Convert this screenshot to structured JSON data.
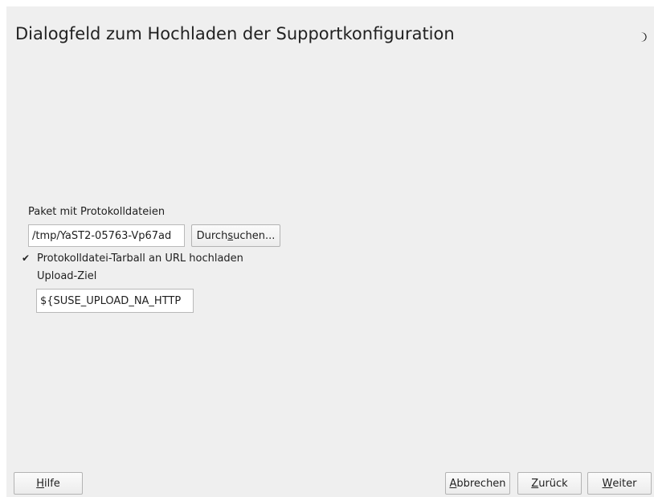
{
  "dialog": {
    "title": "Dialogfeld zum Hochladen der Supportkonfiguration"
  },
  "form": {
    "package_label": "Paket mit Protokolldateien",
    "package_value": "/tmp/YaST2-05763-Vp67ad",
    "browse_label_pre": "Durch",
    "browse_label_mnemonic": "s",
    "browse_label_post": "uchen...",
    "upload_checkbox_checked": true,
    "upload_checkbox_mark": "✔",
    "upload_checkbox_label": "Protokolldatei-Tarball an URL hochladen",
    "upload_target_label": "Upload-Ziel",
    "upload_target_value": "${SUSE_UPLOAD_NA_HTTP"
  },
  "buttons": {
    "help_mnemonic": "H",
    "help_rest": "ilfe",
    "cancel_mnemonic": "A",
    "cancel_rest": "bbrechen",
    "back_mnemonic": "Z",
    "back_rest": "urück",
    "next_mnemonic": "W",
    "next_rest": "eiter"
  },
  "icons": {
    "status": "moon-icon"
  }
}
